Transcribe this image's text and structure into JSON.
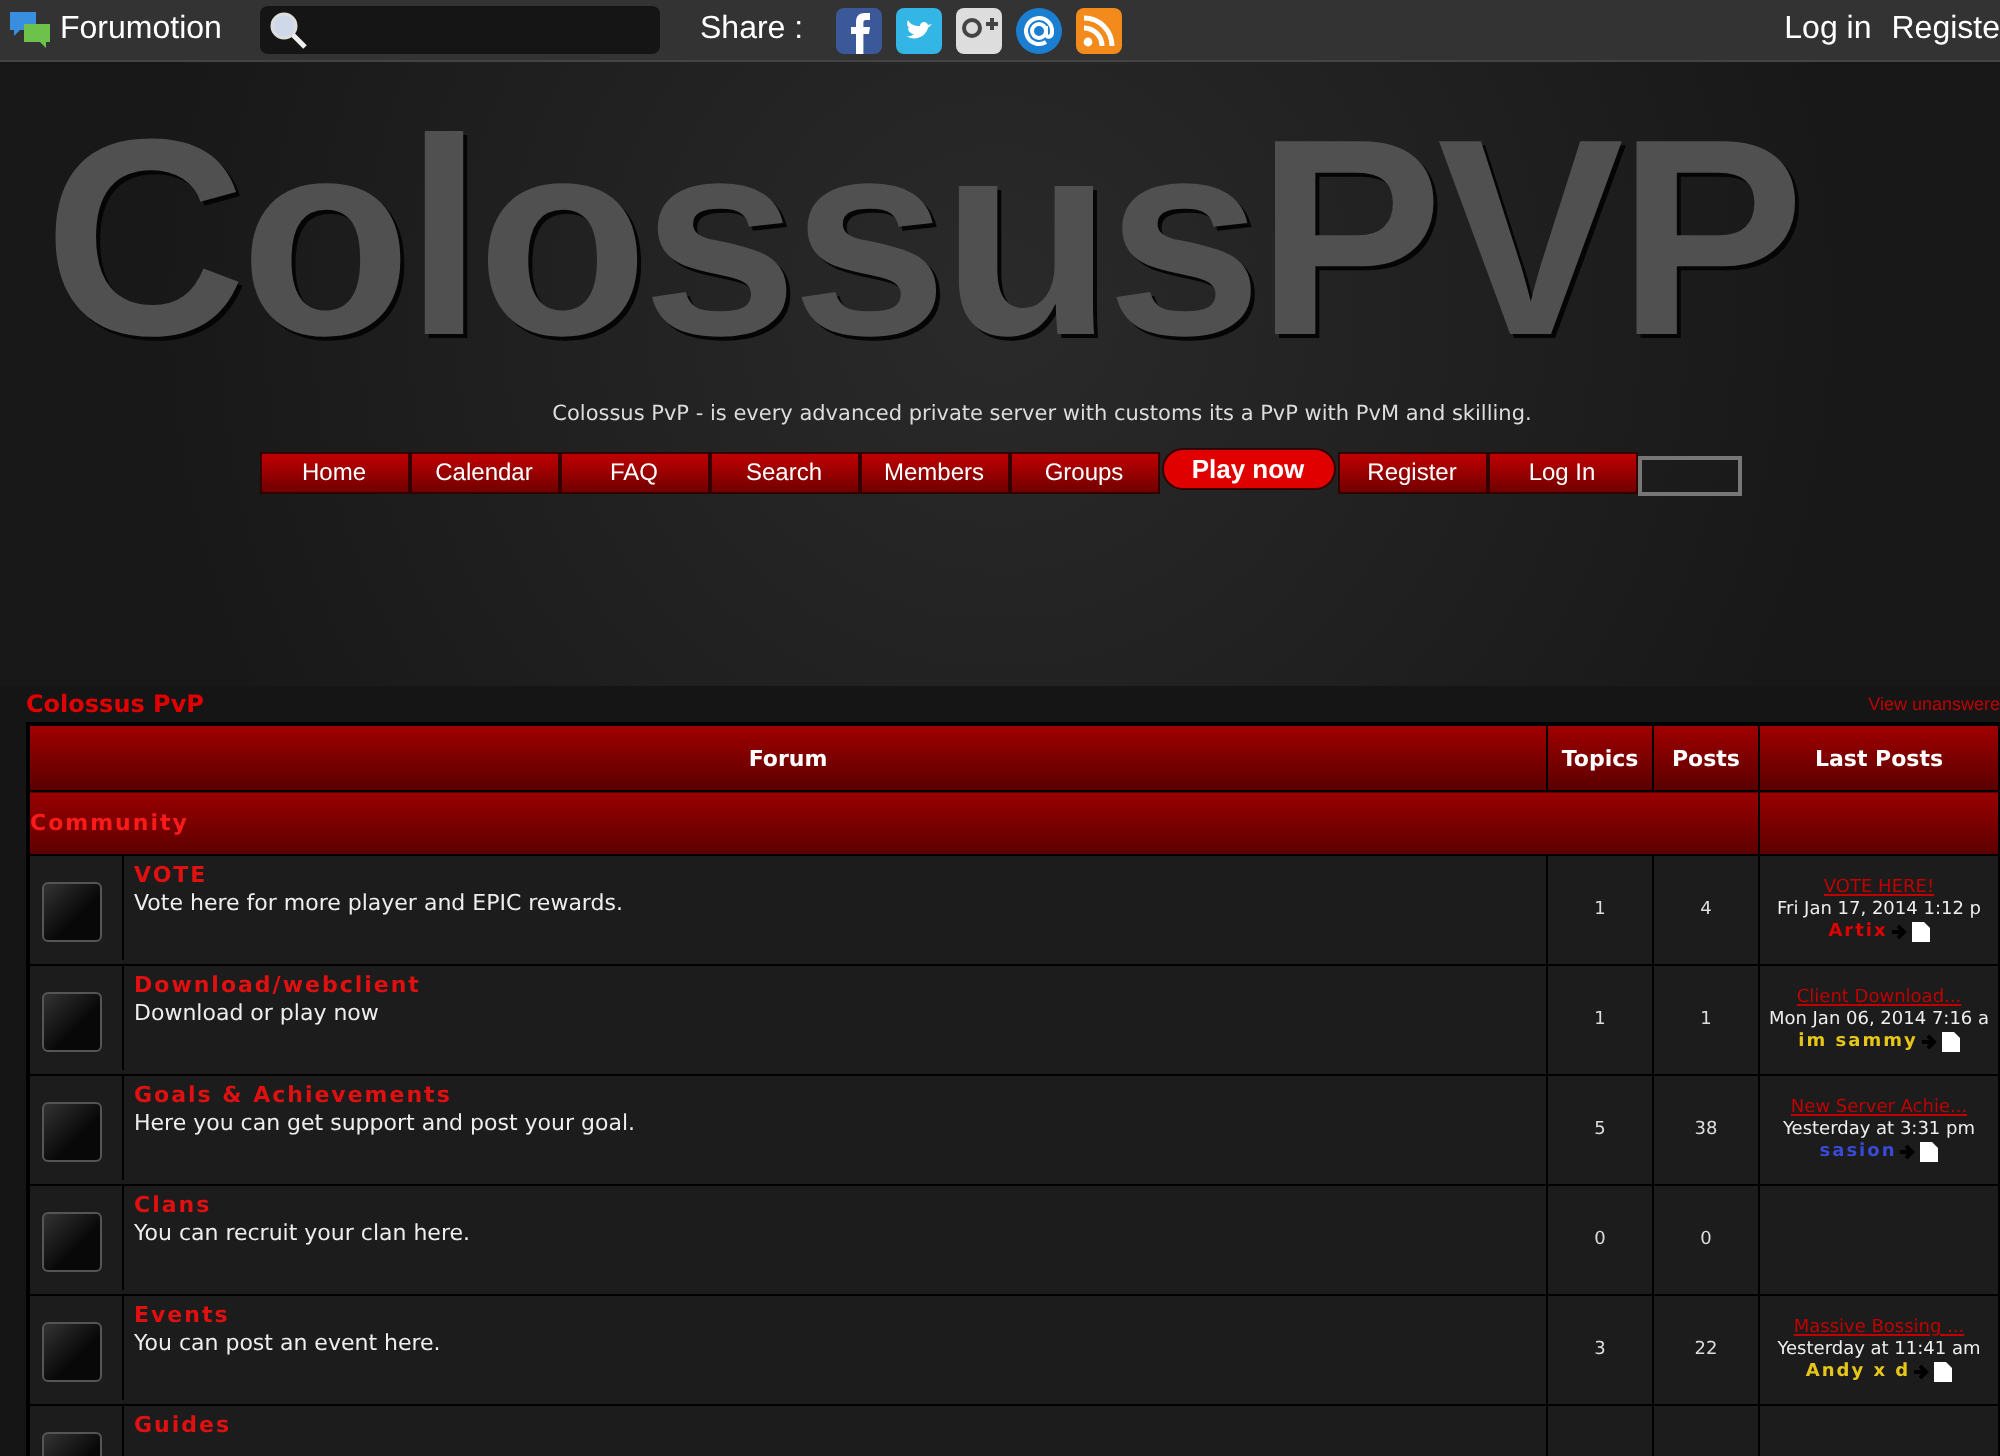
{
  "topbar": {
    "brand": "Forumotion",
    "share_label": "Share :",
    "links": [
      "Log in",
      "Registe"
    ]
  },
  "header": {
    "logo": "ColossusPVP",
    "tagline": "Colossus PvP - is every advanced private server with customs its a PvP with PvM and skilling.",
    "nav": [
      {
        "label": "Home",
        "kind": "tab"
      },
      {
        "label": "Calendar",
        "kind": "tab"
      },
      {
        "label": "FAQ",
        "kind": "tab"
      },
      {
        "label": "Search",
        "kind": "tab"
      },
      {
        "label": "Members",
        "kind": "tab"
      },
      {
        "label": "Groups",
        "kind": "tab"
      },
      {
        "label": "Play now",
        "kind": "highlight"
      },
      {
        "label": "Register",
        "kind": "tab"
      },
      {
        "label": "Log In",
        "kind": "tab"
      },
      {
        "kind": "field"
      }
    ]
  },
  "breadcrumb": "Colossus PvP",
  "view_unanswered": "View unanswere",
  "table": {
    "columns": [
      "Forum",
      "Topics",
      "Posts",
      "Last Posts"
    ],
    "category": "Community",
    "rows": [
      {
        "title": "VOTE",
        "description": "Vote here for more player and EPIC rewards.",
        "topics": "1",
        "posts": "4",
        "last_post": {
          "title": "VOTE HERE!",
          "date": "Fri Jan 17, 2014 1:12 p",
          "author": "Artix",
          "color": "#e00000"
        }
      },
      {
        "title": "Download/webclient",
        "description": "Download or play now",
        "topics": "1",
        "posts": "1",
        "last_post": {
          "title": "Client Download...",
          "date": "Mon Jan 06, 2014 7:16 a",
          "author": "im sammy",
          "color": "#e6c619"
        }
      },
      {
        "title": "Goals & Achievements",
        "description": "Here you can get support and post your goal.",
        "topics": "5",
        "posts": "38",
        "last_post": {
          "title": "New Server Achie...",
          "date": "Yesterday at 3:31 pm",
          "author": "sasion",
          "color": "#3a4ad8"
        }
      },
      {
        "title": "Clans",
        "description": "You can recruit your clan here.",
        "topics": "0",
        "posts": "0",
        "last_post": null
      },
      {
        "title": "Events",
        "description": "You can post an event here.",
        "topics": "3",
        "posts": "22",
        "last_post": {
          "title": "Massive Bossing ...",
          "date": "Yesterday at 11:41 am",
          "author": "Andy x d",
          "color": "#e6c619"
        }
      },
      {
        "title": "Guides",
        "description": "",
        "topics": "",
        "posts": "",
        "last_post": null
      }
    ]
  }
}
